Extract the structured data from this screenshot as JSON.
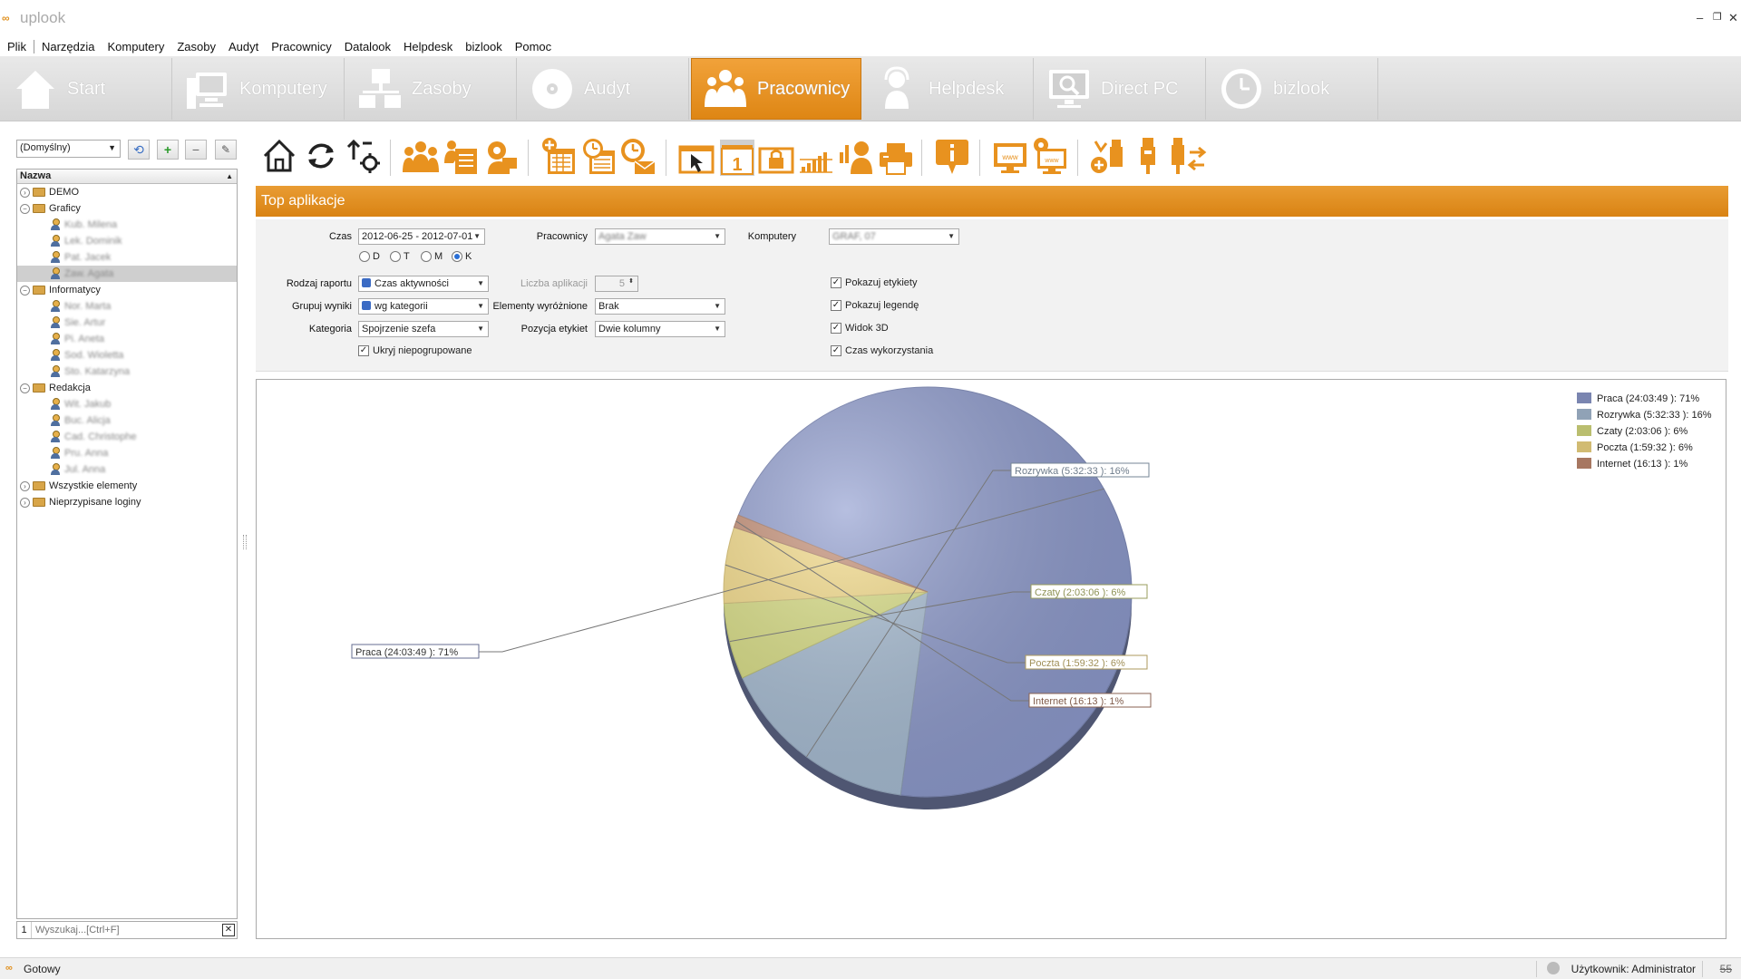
{
  "window": {
    "title": "uplook",
    "logo": "∞",
    "minimize": "–",
    "restore": "❐",
    "close": "✕"
  },
  "menu": [
    "Plik",
    "Narzędzia",
    "Komputery",
    "Zasoby",
    "Audyt",
    "Pracownicy",
    "Datalook",
    "Helpdesk",
    "bizlook",
    "Pomoc"
  ],
  "ribbon": {
    "tabs": [
      {
        "label": "Start",
        "icon": "home-icon"
      },
      {
        "label": "Komputery",
        "icon": "computer-icon"
      },
      {
        "label": "Zasoby",
        "icon": "network-icon"
      },
      {
        "label": "Audyt",
        "icon": "disc-icon"
      },
      {
        "label": "Pracownicy",
        "icon": "people-icon",
        "active": true
      },
      {
        "label": "Helpdesk",
        "icon": "headset-icon"
      },
      {
        "label": "Direct PC",
        "icon": "remote-desktop-icon"
      },
      {
        "label": "bizlook",
        "icon": "clock-icon"
      }
    ],
    "active_color": "#e38d1c"
  },
  "left_panel": {
    "profile_select": "(Domyślny)",
    "tree_header": "Nazwa",
    "tree": [
      {
        "label": "DEMO",
        "type": "folder",
        "level": 0,
        "expanded": false
      },
      {
        "label": "Graficy",
        "type": "folder",
        "level": 0,
        "expanded": true
      },
      {
        "label": "Kub. Milena",
        "type": "user",
        "level": 1,
        "blurred": true
      },
      {
        "label": "Lek. Dominik",
        "type": "user",
        "level": 1,
        "blurred": true
      },
      {
        "label": "Pat. Jacek",
        "type": "user",
        "level": 1,
        "blurred": true
      },
      {
        "label": "Zaw. Agata",
        "type": "user",
        "level": 1,
        "blurred": true,
        "selected": true
      },
      {
        "label": "Informatycy",
        "type": "folder",
        "level": 0,
        "expanded": true
      },
      {
        "label": "Nor. Marta",
        "type": "user",
        "level": 1,
        "blurred": true
      },
      {
        "label": "Sie. Artur",
        "type": "user",
        "level": 1,
        "blurred": true
      },
      {
        "label": "Pi. Aneta",
        "type": "user",
        "level": 1,
        "blurred": true
      },
      {
        "label": "Sod. Wioletta",
        "type": "user",
        "level": 1,
        "blurred": true
      },
      {
        "label": "Sto. Katarzyna",
        "type": "user",
        "level": 1,
        "blurred": true
      },
      {
        "label": "Redakcja",
        "type": "folder",
        "level": 0,
        "expanded": true
      },
      {
        "label": "Wit. Jakub",
        "type": "user",
        "level": 1,
        "blurred": true
      },
      {
        "label": "Buc. Alicja",
        "type": "user",
        "level": 1,
        "blurred": true
      },
      {
        "label": "Cad. Christophe",
        "type": "user",
        "level": 1,
        "blurred": true
      },
      {
        "label": "Pru. Anna",
        "type": "user",
        "level": 1,
        "blurred": true
      },
      {
        "label": "Jul. Anna",
        "type": "user",
        "level": 1,
        "blurred": true
      },
      {
        "label": "Wszystkie elementy",
        "type": "folder",
        "level": 0,
        "expanded": false
      },
      {
        "label": "Nieprzypisane loginy",
        "type": "folder",
        "level": 0,
        "expanded": false
      }
    ],
    "search": {
      "count": "1",
      "placeholder": "Wyszukaj...[Ctrl+F]",
      "clear": "✕"
    }
  },
  "toolbar_icons": [
    "home-outline-icon",
    "refresh-icon",
    "settings-arrows-icon",
    "group-icon",
    "documents-icon",
    "user-settings-icon",
    "calendar-add-icon",
    "calendar-clock-icon",
    "clock-mail-icon",
    "cursor-window-icon",
    "calendar-one-icon",
    "lock-screen-icon",
    "signal-bars-icon",
    "user-chart-icon",
    "printer-icon",
    "info-bubble-icon",
    "www-monitor-icon",
    "www-monitor-settings-icon",
    "usb-add-icon",
    "usb-icon",
    "usb-transfer-icon"
  ],
  "section_title": "Top aplikacje",
  "filters": {
    "czas": {
      "label": "Czas",
      "value": "2012-06-25 - 2012-07-01"
    },
    "period_radios": [
      {
        "label": "D",
        "checked": false
      },
      {
        "label": "T",
        "checked": false
      },
      {
        "label": "M",
        "checked": false
      },
      {
        "label": "K",
        "checked": true
      }
    ],
    "pracownicy": {
      "label": "Pracownicy",
      "value": "Agata Zaw"
    },
    "komputery": {
      "label": "Komputery",
      "value": "GRAF, 07"
    },
    "rodzaj_raportu": {
      "label": "Rodzaj raportu",
      "value": "Czas aktywności"
    },
    "liczba_aplikacji": {
      "label": "Liczba aplikacji",
      "value": "5"
    },
    "grupuj_wyniki": {
      "label": "Grupuj wyniki",
      "value": "wg kategorii"
    },
    "elementy_wyroznione": {
      "label": "Elementy wyróżnione",
      "value": "Brak"
    },
    "kategoria": {
      "label": "Kategoria",
      "value": "Spojrzenie szefa"
    },
    "pozycja_etykiet": {
      "label": "Pozycja etykiet",
      "value": "Dwie kolumny"
    },
    "ukryj_niepogrupowane": {
      "label": "Ukryj niepogrupowane",
      "checked": true
    },
    "pokazuj_etykiety": {
      "label": "Pokazuj etykiety",
      "checked": true
    },
    "pokazuj_legende": {
      "label": "Pokazuj legendę",
      "checked": true
    },
    "widok_3d": {
      "label": "Widok 3D",
      "checked": true
    },
    "czas_wykorzystania": {
      "label": "Czas wykorzystania",
      "checked": true
    }
  },
  "chart_data": {
    "type": "pie",
    "title": "",
    "slices": [
      {
        "name": "Praca",
        "time": "24:03:49",
        "percent": 71,
        "label": "Praca (24:03:49 ): 71%",
        "color": "#8f9ccf"
      },
      {
        "name": "Rozrywka",
        "time": "5:32:33",
        "percent": 16,
        "label": "Rozrywka (5:32:33 ): 16%",
        "color": "#a9bfd6"
      },
      {
        "name": "Czaty",
        "time": "2:03:06",
        "percent": 6,
        "label": "Czaty (2:03:06 ): 6%",
        "color": "#dbe083"
      },
      {
        "name": "Poczta",
        "time": "1:59:32",
        "percent": 6,
        "label": "Poczta (1:59:32 ): 6%",
        "color": "#f6dc86"
      },
      {
        "name": "Internet",
        "time": "16:13",
        "percent": 1,
        "label": "Internet (16:13 ): 1%",
        "color": "#c48c72"
      }
    ],
    "legend_position": "top-right",
    "view_3d": true
  },
  "status": {
    "text": "Gotowy",
    "user": "Użytkownik: Administrator",
    "counter": "55"
  }
}
